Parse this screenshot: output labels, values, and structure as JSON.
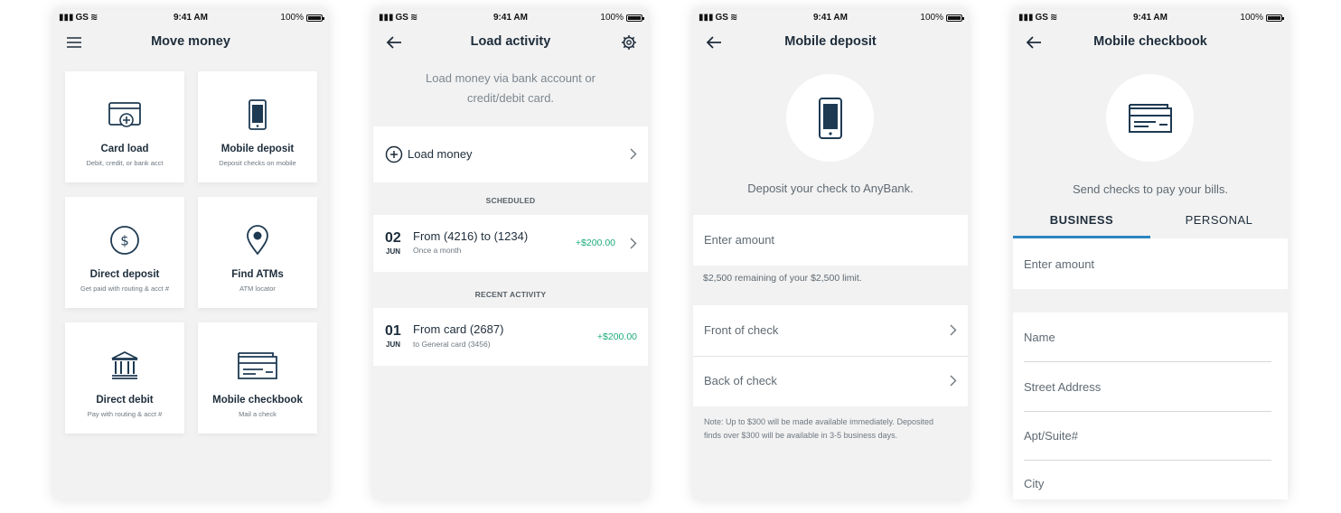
{
  "status_bar": {
    "carrier": "GS",
    "time": "9:41 AM",
    "battery": "100%"
  },
  "screen1": {
    "title": "Move money",
    "tiles": [
      {
        "label": "Card load",
        "sub": "Debit, credit, or bank acct",
        "icon": "card-plus-icon"
      },
      {
        "label": "Mobile deposit",
        "sub": "Deposit checks on mobile",
        "icon": "phone-icon"
      },
      {
        "label": "Direct deposit",
        "sub": "Get paid with routing & acct #",
        "icon": "dollar-circle-icon"
      },
      {
        "label": "Find ATMs",
        "sub": "ATM locator",
        "icon": "map-pin-icon"
      },
      {
        "label": "Direct debit",
        "sub": "Pay with routing & acct #",
        "icon": "bank-icon"
      },
      {
        "label": "Mobile checkbook",
        "sub": "Mail a check",
        "icon": "check-icon"
      }
    ]
  },
  "screen2": {
    "title": "Load activity",
    "intro": "Load money via bank account or credit/debit card.",
    "load_money": "Load money",
    "scheduled_label": "SCHEDULED",
    "scheduled": {
      "day": "02",
      "month": "JUN",
      "title": "From (4216) to (1234)",
      "sub": "Once a month",
      "amount": "+$200.00"
    },
    "recent_label": "RECENT ACTIVITY",
    "recent": {
      "day": "01",
      "month": "JUN",
      "title": "From card (2687)",
      "sub": "to General card (3456)",
      "amount": "+$200.00"
    }
  },
  "screen3": {
    "title": "Mobile deposit",
    "caption": "Deposit your check to AnyBank.",
    "amount_placeholder": "Enter amount",
    "limit_text": "$2,500 remaining of your $2,500 limit.",
    "front": "Front of check",
    "back": "Back of check",
    "note": "Note: Up to $300 will be made available immediately. Deposited finds over $300 will be available in 3-5 business days."
  },
  "screen4": {
    "title": "Mobile checkbook",
    "caption": "Send checks to pay your bills.",
    "tab_business": "BUSINESS",
    "tab_personal": "PERSONAL",
    "amount_placeholder": "Enter amount",
    "name": "Name",
    "street": "Street Address",
    "apt": "Apt/Suite#",
    "city": "City"
  },
  "colors": {
    "accent_green": "#1bab7e",
    "tab_blue": "#2e86c1",
    "icon_navy": "#1e3a52"
  }
}
